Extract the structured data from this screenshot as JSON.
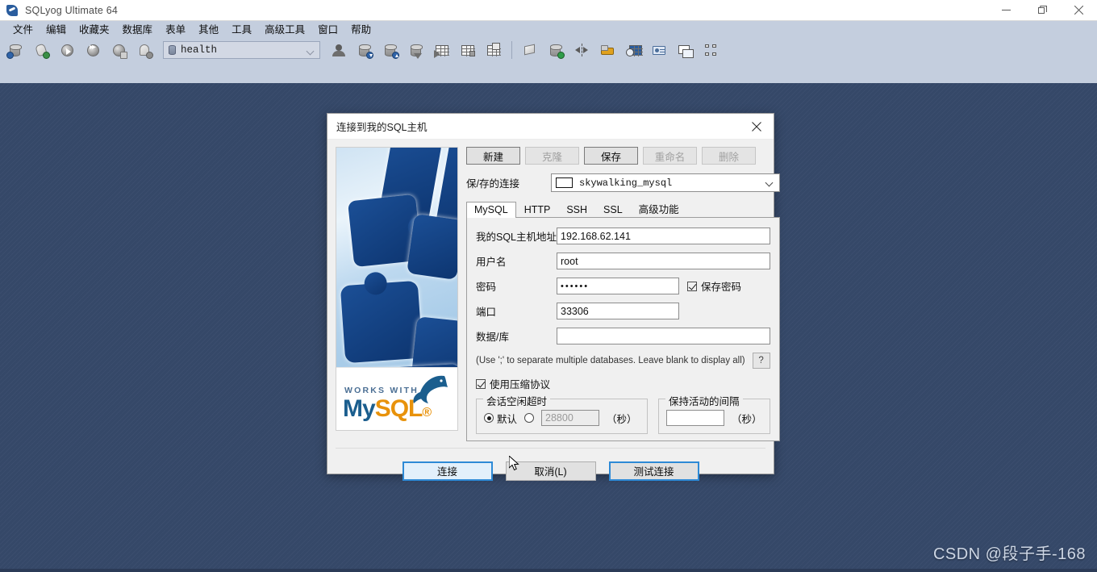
{
  "window": {
    "title": "SQLyog Ultimate 64",
    "icon": "sqlyog-app-icon",
    "controls": {
      "minimize": "minimize-icon",
      "restore": "restore-icon",
      "close": "close-icon"
    }
  },
  "menubar": {
    "items": [
      {
        "label": "文件"
      },
      {
        "label": "编辑"
      },
      {
        "label": "收藏夹"
      },
      {
        "label": "数据库"
      },
      {
        "label": "表单"
      },
      {
        "label": "其他"
      },
      {
        "label": "工具"
      },
      {
        "label": "高级工具"
      },
      {
        "label": "窗口"
      },
      {
        "label": "帮助"
      }
    ]
  },
  "toolbar": {
    "db_selector": {
      "value": "health",
      "icon": "database-icon"
    },
    "icons": [
      "connect-manager-icon",
      "new-connection-icon",
      "execute-query-icon",
      "execute-all-icon",
      "stop-query-icon",
      "refresh-object-icon",
      "user-manager-icon",
      "backup-database-icon",
      "restore-database-icon",
      "import-external-data-icon",
      "export-table-icon",
      "export-as-sql-icon",
      "copy-database-icon",
      "schema-designer-icon",
      "sync-database-icon",
      "compare-data-icon",
      "migration-toolkit-icon",
      "scheduled-backup-icon",
      "notification-services-icon",
      "form-view-icon",
      "database-diagram-icon"
    ]
  },
  "dialog": {
    "title": "连接到我的SQL主机",
    "close_label": "✕",
    "banner": {
      "works_with": "WORKS WITH",
      "brand_my": "My",
      "brand_sql": "SQL",
      "brand_dot": "®"
    },
    "connection_buttons": [
      {
        "label": "新建",
        "enabled": true
      },
      {
        "label": "克隆",
        "enabled": false
      },
      {
        "label": "保存",
        "enabled": true
      },
      {
        "label": "重命名",
        "enabled": false
      },
      {
        "label": "删除",
        "enabled": false
      }
    ],
    "saved_connection": {
      "label": "保/存的连接",
      "value": "skywalking_mysql"
    },
    "tabs": [
      {
        "label": "MySQL",
        "active": true
      },
      {
        "label": "HTTP",
        "active": false
      },
      {
        "label": "SSH",
        "active": false
      },
      {
        "label": "SSL",
        "active": false
      },
      {
        "label": "高级功能",
        "active": false
      }
    ],
    "fields": {
      "host": {
        "label": "我的SQL主机地址",
        "value": "192.168.62.141"
      },
      "user": {
        "label": "用户名",
        "value": "root"
      },
      "password": {
        "label": "密码",
        "value": "••••••"
      },
      "port": {
        "label": "端口",
        "value": "33306"
      },
      "database": {
        "label": "数据/库",
        "value": ""
      }
    },
    "save_password": {
      "label": "保存密码",
      "checked": true
    },
    "hint": "(Use ';' to separate multiple databases. Leave blank to display all)",
    "help_button": "?",
    "compressed_protocol": {
      "label": "使用压缩协议",
      "checked": true
    },
    "session_timeout": {
      "title": "会话空闲超时",
      "default_label": "默认",
      "default_selected": true,
      "custom_selected": false,
      "custom_value": "28800",
      "unit": "（秒）"
    },
    "keep_alive": {
      "title": "保持活动的间隔",
      "value": "",
      "unit": "（秒）"
    },
    "footer_buttons": [
      {
        "label": "连接",
        "state": "focused"
      },
      {
        "label": "取消(L)",
        "state": "normal"
      },
      {
        "label": "测试连接",
        "state": "accent"
      }
    ]
  },
  "watermark": "CSDN @段子手-168",
  "colors": {
    "desktop": "#36496a",
    "toolbar": "#c4cede",
    "accent": "#2e8ad6",
    "dialog_bg": "#f0f0f0",
    "mysql_blue": "#1b5e8e",
    "mysql_orange": "#e8920b"
  }
}
